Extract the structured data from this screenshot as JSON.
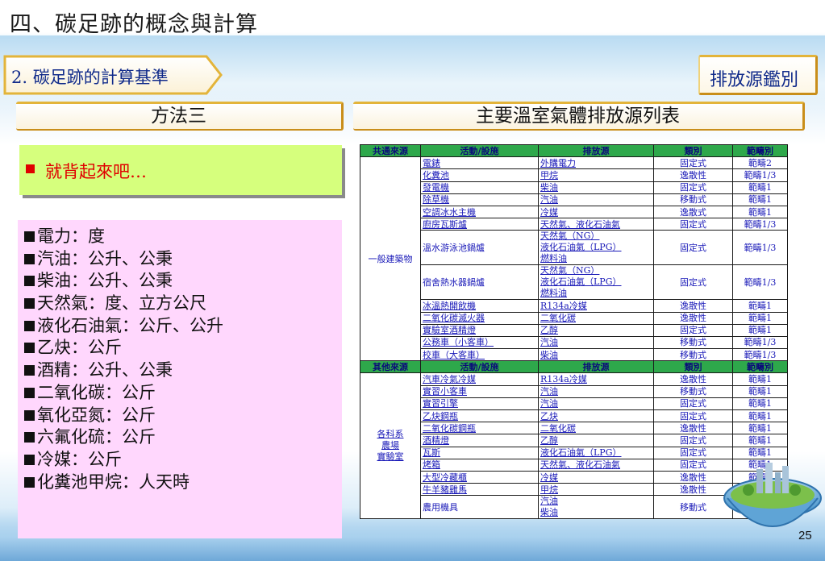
{
  "slide": {
    "title": "四、碳足跡的概念與計算",
    "section_label": "2. 碳足跡的計算基準",
    "right_label": "排放源鑑別",
    "left_header": "方法三",
    "right_header": "主要溫室氣體排放源列表",
    "page_number": "25"
  },
  "callout": {
    "text": "就背起來吧…"
  },
  "units": [
    "電力：度",
    "汽油：公升、公秉",
    "柴油：公升、公秉",
    "天然氣：度、立方公尺",
    "液化石油氣：公斤、公升",
    "乙炔：公斤",
    "酒精：公升、公秉",
    "二氧化碳：公斤",
    "氧化亞氮：公斤",
    "六氟化硫：公斤",
    "冷媒：公斤",
    "化糞池甲烷：人天時"
  ],
  "table1": {
    "headers": [
      "共通來源",
      "活動/設施",
      "排放源",
      "類別",
      "範疇別"
    ],
    "group": "一般建築物",
    "rows": [
      {
        "a": "電錶",
        "s": "外購電力",
        "t": "固定式",
        "r": "範疇2"
      },
      {
        "a": "化糞池",
        "s": "甲烷",
        "t": "逸散性",
        "r": "範疇1/3"
      },
      {
        "a": "發電機",
        "s": "柴油",
        "t": "固定式",
        "r": "範疇1"
      },
      {
        "a": "除草機",
        "s": "汽油",
        "t": "移動式",
        "r": "範疇1"
      },
      {
        "a": "空調冰水主機",
        "s": "冷媒",
        "t": "逸散式",
        "r": "範疇1"
      },
      {
        "a": "廚房瓦斯爐",
        "s": "天然氣、液化石油氣",
        "t": "固定式",
        "r": "範疇1/3"
      },
      {
        "a": "溫水游泳池鍋爐",
        "s": "天然氣（NG）|液化石油氣（LPG）|燃料油",
        "t": "固定式",
        "r": "範疇1/3"
      },
      {
        "a": "宿舍熱水器鍋爐",
        "s": "天然氣（NG）|液化石油氣（LPG）|燃料油",
        "t": "固定式",
        "r": "範疇1/3"
      },
      {
        "a": "冰溫熱開飲機",
        "s": "R134a冷媒",
        "t": "逸散性",
        "r": "範疇1"
      },
      {
        "a": "二氧化碳滅火器",
        "s": "二氧化碳",
        "t": "逸散性",
        "r": "範疇1"
      },
      {
        "a": "實驗室酒精燈",
        "s": "乙醇",
        "t": "固定式",
        "r": "範疇1"
      },
      {
        "a": "公務車（小客車）",
        "s": "汽油",
        "t": "移動式",
        "r": "範疇1/3"
      },
      {
        "a": "校車（大客車）",
        "s": "柴油",
        "t": "移動式",
        "r": "範疇1/3"
      }
    ]
  },
  "table2": {
    "headers": [
      "其他來源",
      "活動/設施",
      "排放源",
      "類別",
      "範疇別"
    ],
    "group": "各科系|農場|實驗室",
    "rows": [
      {
        "a": "汽車冷氣冷媒",
        "s": "R134a冷媒",
        "t": "逸散性",
        "r": "範疇1"
      },
      {
        "a": "實習小客車",
        "s": "汽油",
        "t": "移動式",
        "r": "範疇1"
      },
      {
        "a": "實習引擎",
        "s": "汽油",
        "t": "固定式",
        "r": "範疇1"
      },
      {
        "a": "乙炔鋼瓶",
        "s": "乙炔",
        "t": "固定式",
        "r": "範疇1"
      },
      {
        "a": "二氧化碳鋼瓶",
        "s": "二氧化碳",
        "t": "逸散性",
        "r": "範疇1"
      },
      {
        "a": "酒精燈",
        "s": "乙醇",
        "t": "固定式",
        "r": "範疇1"
      },
      {
        "a": "瓦斯",
        "s": "液化石油氣（LPG）",
        "t": "固定式",
        "r": "範疇1"
      },
      {
        "a": "烤箱",
        "s": "天然氣、液化石油氣",
        "t": "固定式",
        "r": "範疇1"
      },
      {
        "a": "大型冷藏櫃",
        "s": "冷媒",
        "t": "逸散性",
        "r": "範疇1"
      },
      {
        "a": "牛羊豬雞馬",
        "s": "甲烷",
        "t": "逸散性",
        "r": "範疇1"
      },
      {
        "a": "農用機具",
        "s": "汽油|柴油",
        "t": "移動式",
        "r": "範疇1"
      }
    ]
  },
  "colors": {
    "title_blue": "#102a8a",
    "callout_red": "#e00000",
    "green_box": "#d6ff7d",
    "pink_box": "#ffd7fd",
    "table_header_green": "#2ea84b",
    "table_text_blue": "#1a1ab8",
    "tab_gold": "#e3b43a"
  }
}
